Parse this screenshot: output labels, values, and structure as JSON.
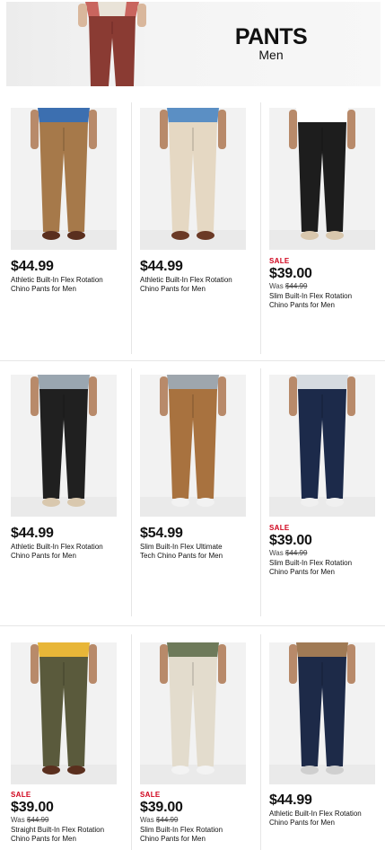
{
  "banner": {
    "title": "PANTS",
    "subtitle": "Men"
  },
  "products": [
    {
      "price": "$44.99",
      "sale": "",
      "was_label": "",
      "was_price": "",
      "name_line1": "Athletic Built-In Flex Rotation",
      "name_line2": "Chino Pants for Men",
      "shirt": "#3c6fb0",
      "pant": "#a6794a",
      "shoe": "#5a2f1e"
    },
    {
      "price": "$44.99",
      "sale": "",
      "was_label": "",
      "was_price": "",
      "name_line1": "Athletic Built-In Flex Rotation",
      "name_line2": "Chino Pants for Men",
      "shirt": "#5b8fc4",
      "pant": "#e5d8c3",
      "shoe": "#6b3a26"
    },
    {
      "price": "$39.00",
      "sale": "SALE",
      "was_label": "Was ",
      "was_price": "$44.99",
      "name_line1": "Slim Built-In Flex Rotation",
      "name_line2": "Chino Pants for Men",
      "shirt": "#ffffff",
      "pant": "#1d1d1d",
      "shoe": "#d8c7ad"
    },
    {
      "price": "$44.99",
      "sale": "",
      "was_label": "",
      "was_price": "",
      "name_line1": "Athletic Built-In Flex Rotation",
      "name_line2": "Chino Pants for Men",
      "shirt": "#9aa6b0",
      "pant": "#202020",
      "shoe": "#d9c8ae"
    },
    {
      "price": "$54.99",
      "sale": "",
      "was_label": "",
      "was_price": "",
      "name_line1": "Slim Built-In Flex Ultimate",
      "name_line2": "Tech Chino Pants for Men",
      "shirt": "#9ea6ad",
      "pant": "#a8723f",
      "shoe": "#f2f2f2"
    },
    {
      "price": "$39.00",
      "sale": "SALE",
      "was_label": "Was ",
      "was_price": "$44.99",
      "name_line1": "Slim Built-In Flex Rotation",
      "name_line2": "Chino Pants for Men",
      "shirt": "#d6dbe0",
      "pant": "#1c2a4a",
      "shoe": "#f0f0f0"
    },
    {
      "price": "$39.00",
      "sale": "SALE",
      "was_label": "Was ",
      "was_price": "$44.99",
      "name_line1": "Straight Built-In Flex Rotation",
      "name_line2": "Chino Pants for Men",
      "shirt": "#e8b638",
      "pant": "#5a5a3c",
      "shoe": "#5a2f1e"
    },
    {
      "price": "$39.00",
      "sale": "SALE",
      "was_label": "Was ",
      "was_price": "$44.99",
      "name_line1": "Slim Built-In Flex Rotation",
      "name_line2": "Chino Pants for Men",
      "shirt": "#6e7a5a",
      "pant": "#e3dccd",
      "shoe": "#f3f3f3"
    },
    {
      "price": "$44.99",
      "sale": "",
      "was_label": "",
      "was_price": "",
      "name_line1": "Athletic Built-In Flex Rotation",
      "name_line2": "Chino Pants for Men",
      "shirt": "#a07a55",
      "pant": "#1d2a48",
      "shoe": "#cfcfcf"
    }
  ],
  "colors": {
    "sale": "#d0021b",
    "banner_pants": "#8a3b33",
    "banner_shirt": "#c9655e"
  }
}
